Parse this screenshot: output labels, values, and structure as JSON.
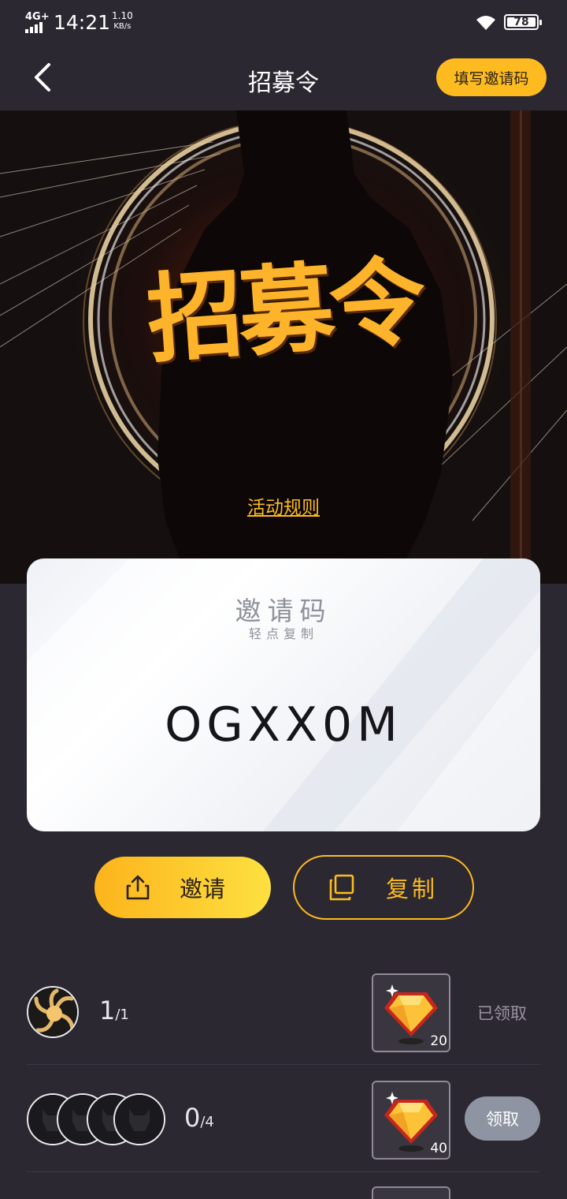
{
  "status_bar": {
    "network": "4G+",
    "time": "14:21",
    "speed_value": "1.10",
    "speed_unit": "KB/s",
    "battery": "78"
  },
  "nav": {
    "title": "招募令",
    "fill_invite_code_label": "填写邀请码"
  },
  "hero": {
    "title_art": "招募令",
    "rules_link": "活动规则"
  },
  "invite_card": {
    "title": "邀请码",
    "subtitle": "轻点复制",
    "code": "OGXX0M"
  },
  "actions": {
    "invite_label": "邀请",
    "copy_label": "复制"
  },
  "rewards": [
    {
      "count": "1",
      "total": "/1",
      "gift_amount": "20",
      "status": "已领取",
      "claimed": true
    },
    {
      "count": "0",
      "total": "/4",
      "gift_amount": "40",
      "status": "领取",
      "claimed": false
    }
  ],
  "colors": {
    "accent": "#fdbb1f",
    "background": "#2c2832",
    "claim_button": "#8f94a3"
  },
  "icons": {
    "back": "chevron-left-icon",
    "share": "share-icon",
    "copy": "copy-icon",
    "gift": "gem-icon",
    "wifi": "wifi-icon",
    "battery": "battery-icon"
  }
}
